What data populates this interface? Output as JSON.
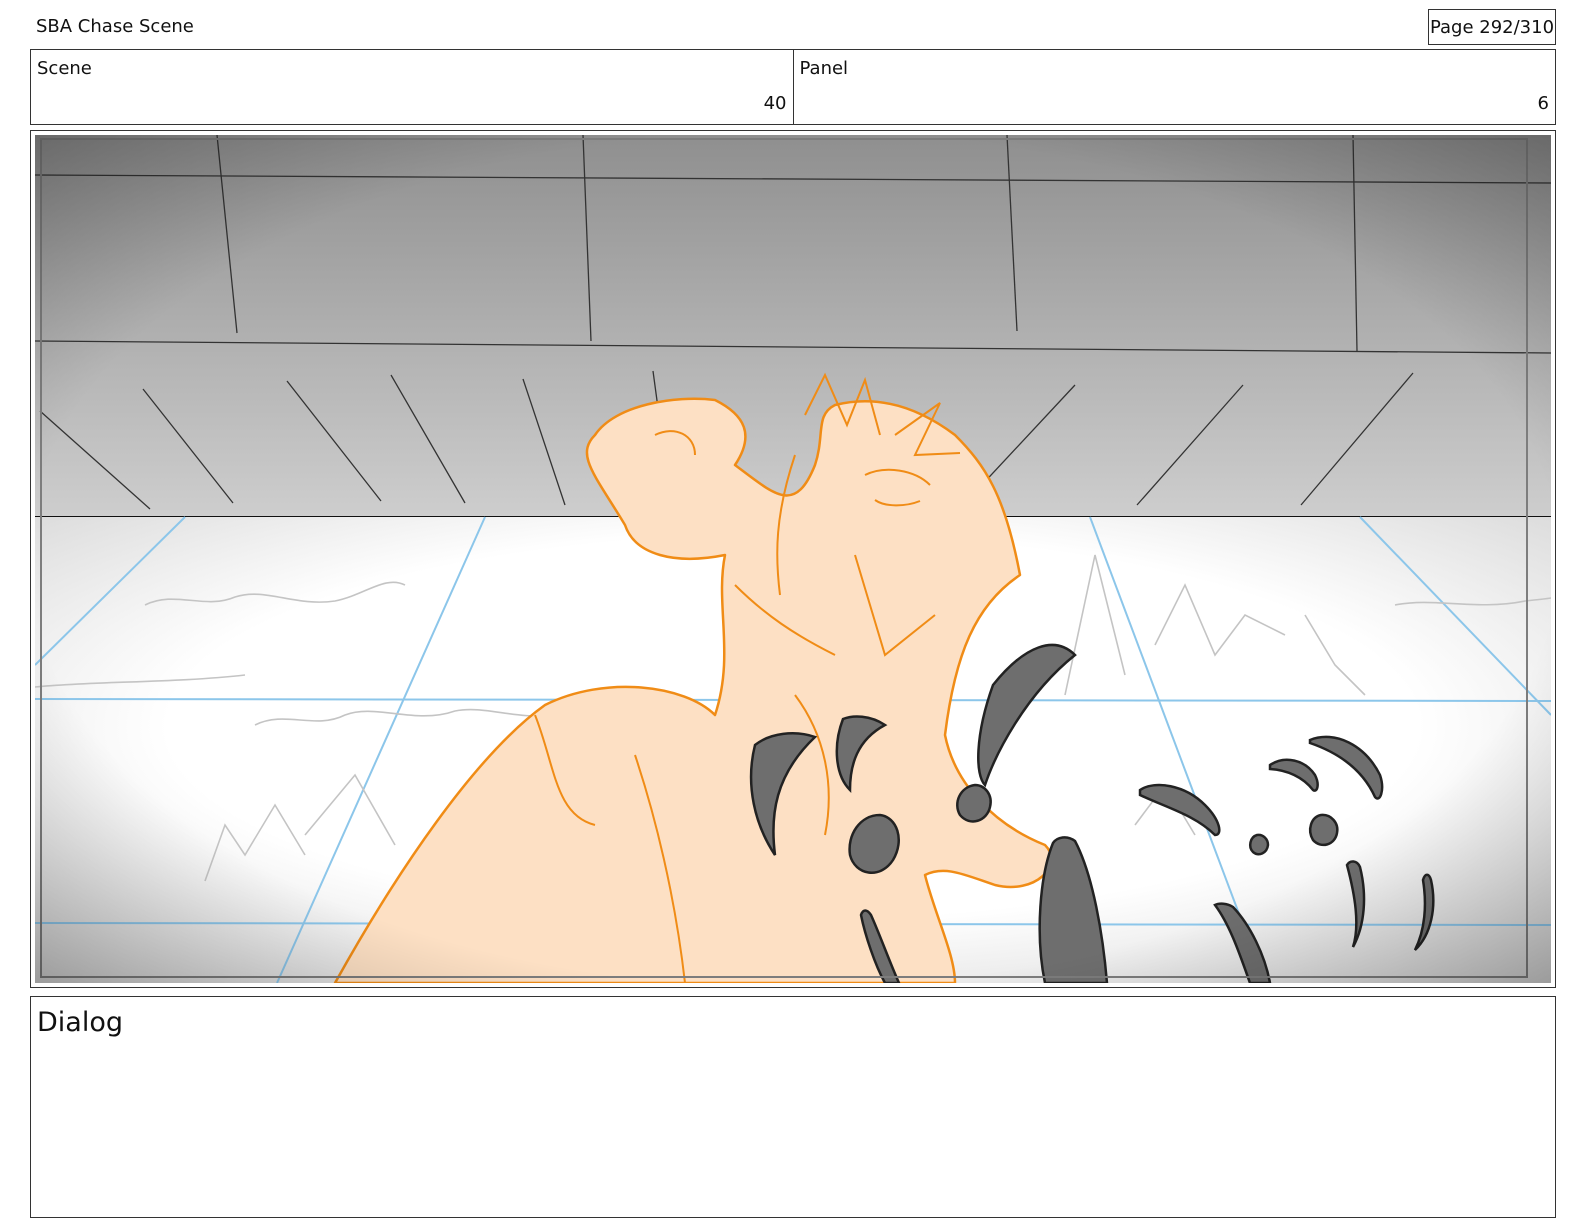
{
  "header": {
    "project_title": "SBA Chase Scene",
    "page_indicator": "Page 292/310"
  },
  "info": {
    "scene_label": "Scene",
    "scene_value": "40",
    "panel_label": "Panel",
    "panel_value": "6"
  },
  "dialog": {
    "label": "Dialog",
    "text": ""
  }
}
